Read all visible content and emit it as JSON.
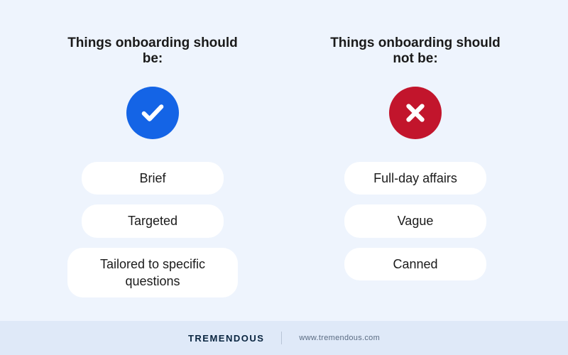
{
  "left": {
    "heading": "Things onboarding should be:",
    "items": [
      "Brief",
      "Targeted",
      "Tailored to specific questions"
    ]
  },
  "right": {
    "heading": "Things onboarding should not be:",
    "items": [
      "Full-day affairs",
      "Vague",
      "Canned"
    ]
  },
  "footer": {
    "brand": "TREMENDOUS",
    "url": "www.tremendous.com"
  },
  "colors": {
    "check_bg": "#1464e6",
    "cross_bg": "#c2152c"
  }
}
